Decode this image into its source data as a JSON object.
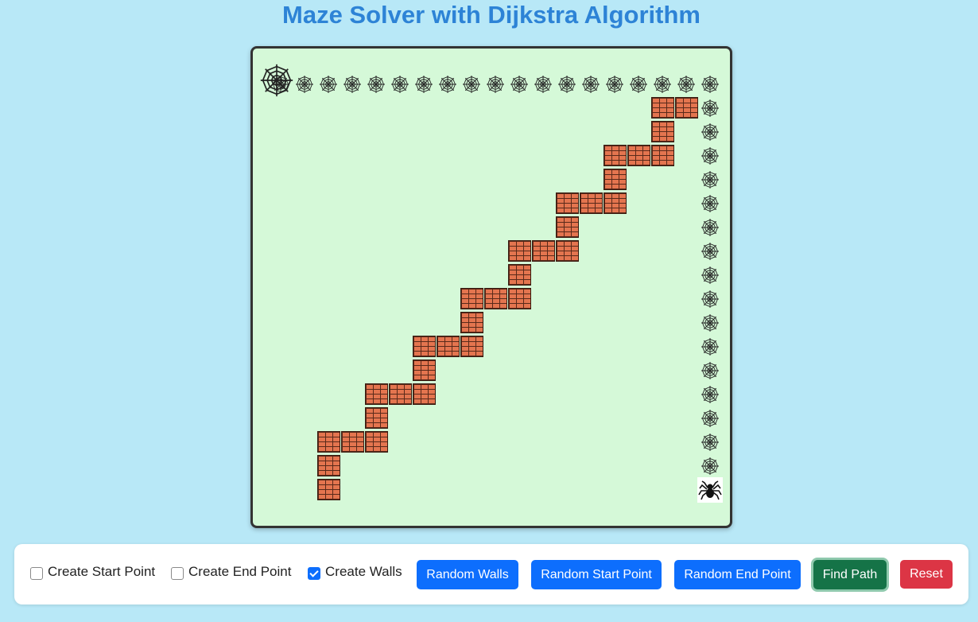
{
  "title": "Maze Solver with Dijkstra Algorithm",
  "grid": {
    "cols": 20,
    "rows": 20,
    "start": [
      0,
      0
    ],
    "end": [
      18,
      17
    ],
    "walls": [
      [
        16,
        1
      ],
      [
        17,
        1
      ],
      [
        16,
        2
      ],
      [
        14,
        3
      ],
      [
        15,
        3
      ],
      [
        16,
        3
      ],
      [
        14,
        4
      ],
      [
        12,
        5
      ],
      [
        13,
        5
      ],
      [
        14,
        5
      ],
      [
        12,
        6
      ],
      [
        10,
        7
      ],
      [
        11,
        7
      ],
      [
        12,
        7
      ],
      [
        10,
        8
      ],
      [
        8,
        9
      ],
      [
        9,
        9
      ],
      [
        10,
        9
      ],
      [
        8,
        10
      ],
      [
        6,
        11
      ],
      [
        7,
        11
      ],
      [
        8,
        11
      ],
      [
        6,
        12
      ],
      [
        4,
        13
      ],
      [
        5,
        13
      ],
      [
        6,
        13
      ],
      [
        4,
        14
      ],
      [
        2,
        15
      ],
      [
        3,
        15
      ],
      [
        4,
        15
      ],
      [
        2,
        16
      ],
      [
        2,
        17
      ]
    ],
    "path": [
      [
        0,
        0
      ],
      [
        1,
        0
      ],
      [
        2,
        0
      ],
      [
        3,
        0
      ],
      [
        4,
        0
      ],
      [
        5,
        0
      ],
      [
        6,
        0
      ],
      [
        7,
        0
      ],
      [
        8,
        0
      ],
      [
        9,
        0
      ],
      [
        10,
        0
      ],
      [
        11,
        0
      ],
      [
        12,
        0
      ],
      [
        13,
        0
      ],
      [
        14,
        0
      ],
      [
        15,
        0
      ],
      [
        16,
        0
      ],
      [
        17,
        0
      ],
      [
        18,
        0
      ],
      [
        18,
        1
      ],
      [
        18,
        2
      ],
      [
        18,
        3
      ],
      [
        18,
        4
      ],
      [
        18,
        5
      ],
      [
        18,
        6
      ],
      [
        18,
        7
      ],
      [
        18,
        8
      ],
      [
        18,
        9
      ],
      [
        18,
        10
      ],
      [
        18,
        11
      ],
      [
        18,
        12
      ],
      [
        18,
        13
      ],
      [
        18,
        14
      ],
      [
        18,
        15
      ],
      [
        18,
        16
      ]
    ]
  },
  "colors": {
    "board": "#d5f9d8",
    "page": "#b8e8f7",
    "title": "#2d83d6",
    "brick": "#e4754f"
  },
  "icons": {
    "start": "large-spiderweb-icon",
    "path": "spiderweb-icon",
    "end": "spider-icon",
    "wall": "brick-wall-icon"
  },
  "controls": {
    "create_start": {
      "label": "Create Start Point",
      "checked": false
    },
    "create_end": {
      "label": "Create End Point",
      "checked": false
    },
    "create_walls": {
      "label": "Create Walls",
      "checked": true
    },
    "random_walls": "Random Walls",
    "random_start": "Random Start Point",
    "random_end": "Random End Point",
    "find_path": "Find Path",
    "reset": "Reset"
  }
}
